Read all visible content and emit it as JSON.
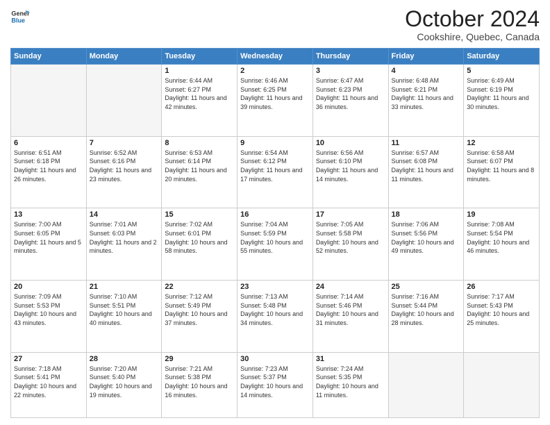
{
  "logo": {
    "line1": "General",
    "line2": "Blue"
  },
  "header": {
    "month": "October 2024",
    "location": "Cookshire, Quebec, Canada"
  },
  "days_of_week": [
    "Sunday",
    "Monday",
    "Tuesday",
    "Wednesday",
    "Thursday",
    "Friday",
    "Saturday"
  ],
  "weeks": [
    [
      {
        "day": "",
        "sunrise": "",
        "sunset": "",
        "daylight": ""
      },
      {
        "day": "",
        "sunrise": "",
        "sunset": "",
        "daylight": ""
      },
      {
        "day": "1",
        "sunrise": "Sunrise: 6:44 AM",
        "sunset": "Sunset: 6:27 PM",
        "daylight": "Daylight: 11 hours and 42 minutes."
      },
      {
        "day": "2",
        "sunrise": "Sunrise: 6:46 AM",
        "sunset": "Sunset: 6:25 PM",
        "daylight": "Daylight: 11 hours and 39 minutes."
      },
      {
        "day": "3",
        "sunrise": "Sunrise: 6:47 AM",
        "sunset": "Sunset: 6:23 PM",
        "daylight": "Daylight: 11 hours and 36 minutes."
      },
      {
        "day": "4",
        "sunrise": "Sunrise: 6:48 AM",
        "sunset": "Sunset: 6:21 PM",
        "daylight": "Daylight: 11 hours and 33 minutes."
      },
      {
        "day": "5",
        "sunrise": "Sunrise: 6:49 AM",
        "sunset": "Sunset: 6:19 PM",
        "daylight": "Daylight: 11 hours and 30 minutes."
      }
    ],
    [
      {
        "day": "6",
        "sunrise": "Sunrise: 6:51 AM",
        "sunset": "Sunset: 6:18 PM",
        "daylight": "Daylight: 11 hours and 26 minutes."
      },
      {
        "day": "7",
        "sunrise": "Sunrise: 6:52 AM",
        "sunset": "Sunset: 6:16 PM",
        "daylight": "Daylight: 11 hours and 23 minutes."
      },
      {
        "day": "8",
        "sunrise": "Sunrise: 6:53 AM",
        "sunset": "Sunset: 6:14 PM",
        "daylight": "Daylight: 11 hours and 20 minutes."
      },
      {
        "day": "9",
        "sunrise": "Sunrise: 6:54 AM",
        "sunset": "Sunset: 6:12 PM",
        "daylight": "Daylight: 11 hours and 17 minutes."
      },
      {
        "day": "10",
        "sunrise": "Sunrise: 6:56 AM",
        "sunset": "Sunset: 6:10 PM",
        "daylight": "Daylight: 11 hours and 14 minutes."
      },
      {
        "day": "11",
        "sunrise": "Sunrise: 6:57 AM",
        "sunset": "Sunset: 6:08 PM",
        "daylight": "Daylight: 11 hours and 11 minutes."
      },
      {
        "day": "12",
        "sunrise": "Sunrise: 6:58 AM",
        "sunset": "Sunset: 6:07 PM",
        "daylight": "Daylight: 11 hours and 8 minutes."
      }
    ],
    [
      {
        "day": "13",
        "sunrise": "Sunrise: 7:00 AM",
        "sunset": "Sunset: 6:05 PM",
        "daylight": "Daylight: 11 hours and 5 minutes."
      },
      {
        "day": "14",
        "sunrise": "Sunrise: 7:01 AM",
        "sunset": "Sunset: 6:03 PM",
        "daylight": "Daylight: 11 hours and 2 minutes."
      },
      {
        "day": "15",
        "sunrise": "Sunrise: 7:02 AM",
        "sunset": "Sunset: 6:01 PM",
        "daylight": "Daylight: 10 hours and 58 minutes."
      },
      {
        "day": "16",
        "sunrise": "Sunrise: 7:04 AM",
        "sunset": "Sunset: 5:59 PM",
        "daylight": "Daylight: 10 hours and 55 minutes."
      },
      {
        "day": "17",
        "sunrise": "Sunrise: 7:05 AM",
        "sunset": "Sunset: 5:58 PM",
        "daylight": "Daylight: 10 hours and 52 minutes."
      },
      {
        "day": "18",
        "sunrise": "Sunrise: 7:06 AM",
        "sunset": "Sunset: 5:56 PM",
        "daylight": "Daylight: 10 hours and 49 minutes."
      },
      {
        "day": "19",
        "sunrise": "Sunrise: 7:08 AM",
        "sunset": "Sunset: 5:54 PM",
        "daylight": "Daylight: 10 hours and 46 minutes."
      }
    ],
    [
      {
        "day": "20",
        "sunrise": "Sunrise: 7:09 AM",
        "sunset": "Sunset: 5:53 PM",
        "daylight": "Daylight: 10 hours and 43 minutes."
      },
      {
        "day": "21",
        "sunrise": "Sunrise: 7:10 AM",
        "sunset": "Sunset: 5:51 PM",
        "daylight": "Daylight: 10 hours and 40 minutes."
      },
      {
        "day": "22",
        "sunrise": "Sunrise: 7:12 AM",
        "sunset": "Sunset: 5:49 PM",
        "daylight": "Daylight: 10 hours and 37 minutes."
      },
      {
        "day": "23",
        "sunrise": "Sunrise: 7:13 AM",
        "sunset": "Sunset: 5:48 PM",
        "daylight": "Daylight: 10 hours and 34 minutes."
      },
      {
        "day": "24",
        "sunrise": "Sunrise: 7:14 AM",
        "sunset": "Sunset: 5:46 PM",
        "daylight": "Daylight: 10 hours and 31 minutes."
      },
      {
        "day": "25",
        "sunrise": "Sunrise: 7:16 AM",
        "sunset": "Sunset: 5:44 PM",
        "daylight": "Daylight: 10 hours and 28 minutes."
      },
      {
        "day": "26",
        "sunrise": "Sunrise: 7:17 AM",
        "sunset": "Sunset: 5:43 PM",
        "daylight": "Daylight: 10 hours and 25 minutes."
      }
    ],
    [
      {
        "day": "27",
        "sunrise": "Sunrise: 7:18 AM",
        "sunset": "Sunset: 5:41 PM",
        "daylight": "Daylight: 10 hours and 22 minutes."
      },
      {
        "day": "28",
        "sunrise": "Sunrise: 7:20 AM",
        "sunset": "Sunset: 5:40 PM",
        "daylight": "Daylight: 10 hours and 19 minutes."
      },
      {
        "day": "29",
        "sunrise": "Sunrise: 7:21 AM",
        "sunset": "Sunset: 5:38 PM",
        "daylight": "Daylight: 10 hours and 16 minutes."
      },
      {
        "day": "30",
        "sunrise": "Sunrise: 7:23 AM",
        "sunset": "Sunset: 5:37 PM",
        "daylight": "Daylight: 10 hours and 14 minutes."
      },
      {
        "day": "31",
        "sunrise": "Sunrise: 7:24 AM",
        "sunset": "Sunset: 5:35 PM",
        "daylight": "Daylight: 10 hours and 11 minutes."
      },
      {
        "day": "",
        "sunrise": "",
        "sunset": "",
        "daylight": ""
      },
      {
        "day": "",
        "sunrise": "",
        "sunset": "",
        "daylight": ""
      }
    ]
  ]
}
